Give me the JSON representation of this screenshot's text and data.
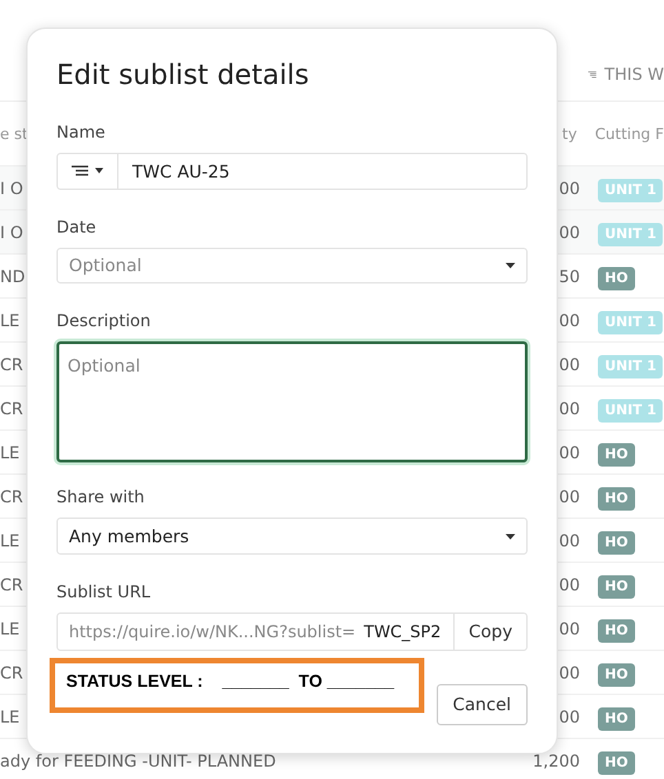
{
  "background": {
    "view_button": "THIS W",
    "header": {
      "column_1": "e st",
      "qty": "ty",
      "cutting": "Cutting F"
    },
    "rows": [
      {
        "column_1": "I O",
        "qty": "00",
        "tag": {
          "label": "UNIT 1",
          "color": "#ade3e8"
        }
      },
      {
        "column_1": "I O",
        "qty": "00",
        "tag": {
          "label": "UNIT 1",
          "color": "#ade3e8"
        }
      },
      {
        "column_1": "ND",
        "qty": "50",
        "tag": {
          "label": "HO",
          "color": "#7b9e9a"
        }
      },
      {
        "column_1": "LE",
        "qty": "00",
        "tag": {
          "label": "UNIT 1",
          "color": "#ade3e8"
        }
      },
      {
        "column_1": "CR",
        "qty": "00",
        "tag": {
          "label": "UNIT 1",
          "color": "#ade3e8"
        }
      },
      {
        "column_1": "CR",
        "qty": "00",
        "tag": {
          "label": "UNIT 1",
          "color": "#ade3e8"
        }
      },
      {
        "column_1": "LE",
        "qty": "00",
        "tag": {
          "label": "HO",
          "color": "#7b9e9a"
        }
      },
      {
        "column_1": "CR",
        "qty": "00",
        "tag": {
          "label": "HO",
          "color": "#7b9e9a"
        }
      },
      {
        "column_1": "LE",
        "qty": "00",
        "tag": {
          "label": "HO",
          "color": "#7b9e9a"
        }
      },
      {
        "column_1": "CR",
        "qty": "00",
        "tag": {
          "label": "HO",
          "color": "#7b9e9a"
        }
      },
      {
        "column_1": "LE",
        "qty": "00",
        "tag": {
          "label": "HO",
          "color": "#7b9e9a"
        }
      },
      {
        "column_1": "CR",
        "qty": "00",
        "tag": {
          "label": "HO",
          "color": "#7b9e9a"
        }
      },
      {
        "column_1": "LE",
        "qty": "00",
        "tag": {
          "label": "HO",
          "color": "#7b9e9a"
        }
      },
      {
        "column_1": "ady for FEEDING -UNIT- PLANNED",
        "qty": "1,200",
        "tag": {
          "label": "HO",
          "color": "#7b9e9a"
        }
      }
    ]
  },
  "dialog": {
    "title": "Edit sublist details",
    "name": {
      "label": "Name",
      "value": "TWC AU-25"
    },
    "date": {
      "label": "Date",
      "placeholder": "Optional"
    },
    "description": {
      "label": "Description",
      "placeholder": "Optional",
      "focused": true
    },
    "share_with": {
      "label": "Share with",
      "value": "Any members"
    },
    "sublist_url": {
      "label": "Sublist URL",
      "prefix": "https://quire.io/w/NK...NG?sublist=",
      "value": "TWC_SP2",
      "copy_button": "Copy"
    },
    "buttons": [
      {
        "label": "Cancel",
        "disabled": false
      }
    ]
  },
  "annotation": {
    "text": "STATUS LEVEL :    _______  TO _______"
  }
}
